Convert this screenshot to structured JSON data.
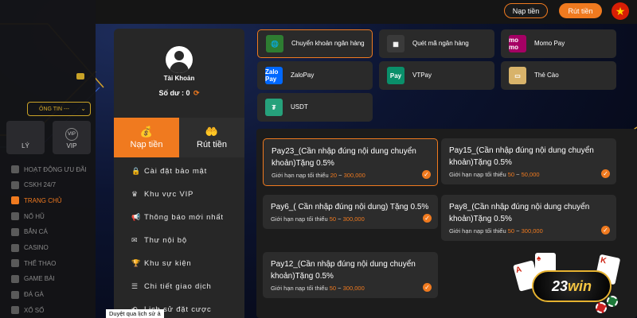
{
  "header": {
    "deposit_button": "Nạp tiền",
    "withdraw_button": "Rút tiền",
    "flag": "★"
  },
  "leftnav": {
    "select_label": "ÔNG TIN ---",
    "box_ly": "LÝ",
    "box_vip": "VIP",
    "vip_icon_text": "VIP",
    "items": [
      {
        "label": "HOẠT ĐỘNG ƯU ĐÃI",
        "icon": "gift-icon"
      },
      {
        "label": "CSKH 24/7",
        "icon": "support-icon"
      },
      {
        "label": "TRANG CHỦ",
        "icon": "home-icon",
        "active": true
      },
      {
        "label": "NỔ HŨ",
        "icon": "slot-icon"
      },
      {
        "label": "BẮN CÁ",
        "icon": "fish-icon"
      },
      {
        "label": "CASINO",
        "icon": "casino-icon"
      },
      {
        "label": "THỂ THAO",
        "icon": "sport-icon"
      },
      {
        "label": "GAME BÀI",
        "icon": "card-game-icon"
      },
      {
        "label": "ĐÁ GÀ",
        "icon": "rooster-icon"
      },
      {
        "label": "XỔ SỐ",
        "icon": "lottery-icon"
      }
    ]
  },
  "account": {
    "title": "Tài Khoản",
    "balance_label": "Số dư : 0",
    "refresh_icon": "⟳",
    "tab_deposit": "Nạp tiền",
    "tab_withdraw": "Rút tiền",
    "menu": [
      {
        "label": "Cài đặt bảo mật",
        "icon": "lock-icon",
        "glyph": "🔒"
      },
      {
        "label": "Khu vực VIP",
        "icon": "crown-icon",
        "glyph": "♛"
      },
      {
        "label": "Thông báo mới nhất",
        "icon": "megaphone-icon",
        "glyph": "📢"
      },
      {
        "label": "Thư nội bộ",
        "icon": "mail-icon",
        "glyph": "✉"
      },
      {
        "label": "Khu sự kiện",
        "icon": "trophy-icon",
        "glyph": "🏆"
      },
      {
        "label": "Chi tiết giao dịch",
        "icon": "list-icon",
        "glyph": "☰"
      },
      {
        "label": "Lịch sử đặt cược",
        "icon": "history-icon",
        "glyph": "⟲"
      }
    ]
  },
  "payment_methods": [
    {
      "label": "Chuyển khoản ngân hàng",
      "icon": "globe-bank-icon",
      "icon_text": "🌐",
      "selected": true,
      "color": "#2e7d32"
    },
    {
      "label": "Quét mã ngân hàng",
      "icon": "qr-scan-icon",
      "icon_text": "▦",
      "selected": false,
      "color": "#3a3a3a"
    },
    {
      "label": "Momo Pay",
      "icon": "momo-icon",
      "icon_text": "mo mo",
      "selected": false,
      "color": "#a50064"
    },
    {
      "label": "ZaloPay",
      "icon": "zalopay-icon",
      "icon_text": "Zalo Pay",
      "selected": false,
      "color": "#0068ff"
    },
    {
      "label": "VTPay",
      "icon": "vtpay-icon",
      "icon_text": "Pay",
      "selected": false,
      "color": "#0a8f6a"
    },
    {
      "label": "Thẻ Cào",
      "icon": "scratch-card-icon",
      "icon_text": "▭",
      "selected": false,
      "color": "#d8b36a"
    },
    {
      "label": "USDT",
      "icon": "tether-icon",
      "icon_text": "₮",
      "selected": false,
      "color": "#26a17b"
    }
  ],
  "promotions": [
    {
      "title": "Pay23_(Cần nhập đúng nội dung chuyển khoản)Tặng 0.5%",
      "limit_prefix": "Giới hạn nạp tối thiểu ",
      "min": "20",
      "sep": " ~ ",
      "max": "300,000",
      "selected": true
    },
    {
      "title": "Pay15_(Cần nhập đúng nội dung chuyển khoản)Tặng 0.5%",
      "limit_prefix": "Giới hạn nạp tối thiểu ",
      "min": "50",
      "sep": " ~ ",
      "max": "50,000",
      "selected": false
    },
    {
      "title": "Pay6_( Cần nhập đúng nội dung) Tặng 0.5%",
      "limit_prefix": "Giới hạn nạp tối thiểu ",
      "min": "50",
      "sep": " ~ ",
      "max": "300,000",
      "selected": false
    },
    {
      "title": "Pay8_(Cần nhập đúng nội dung chuyển khoản)Tặng 0.5%",
      "limit_prefix": "Giới hạn nạp tối thiểu ",
      "min": "50",
      "sep": " ~ ",
      "max": "300,000",
      "selected": false
    },
    {
      "title": "Pay12_(Cần nhập đúng nội dung chuyển khoản)Tặng 0.5%",
      "limit_prefix": "Giới hạn nạp tối thiểu ",
      "min": "50",
      "sep": " ~ ",
      "max": "300,000",
      "selected": false
    }
  ],
  "logo": {
    "text_a": "23",
    "text_b": "win"
  },
  "tooltip": "Duyệt qua lịch sử ả",
  "colors": {
    "accent": "#f07a1f",
    "panel": "#272727",
    "gold": "#e6b230"
  }
}
